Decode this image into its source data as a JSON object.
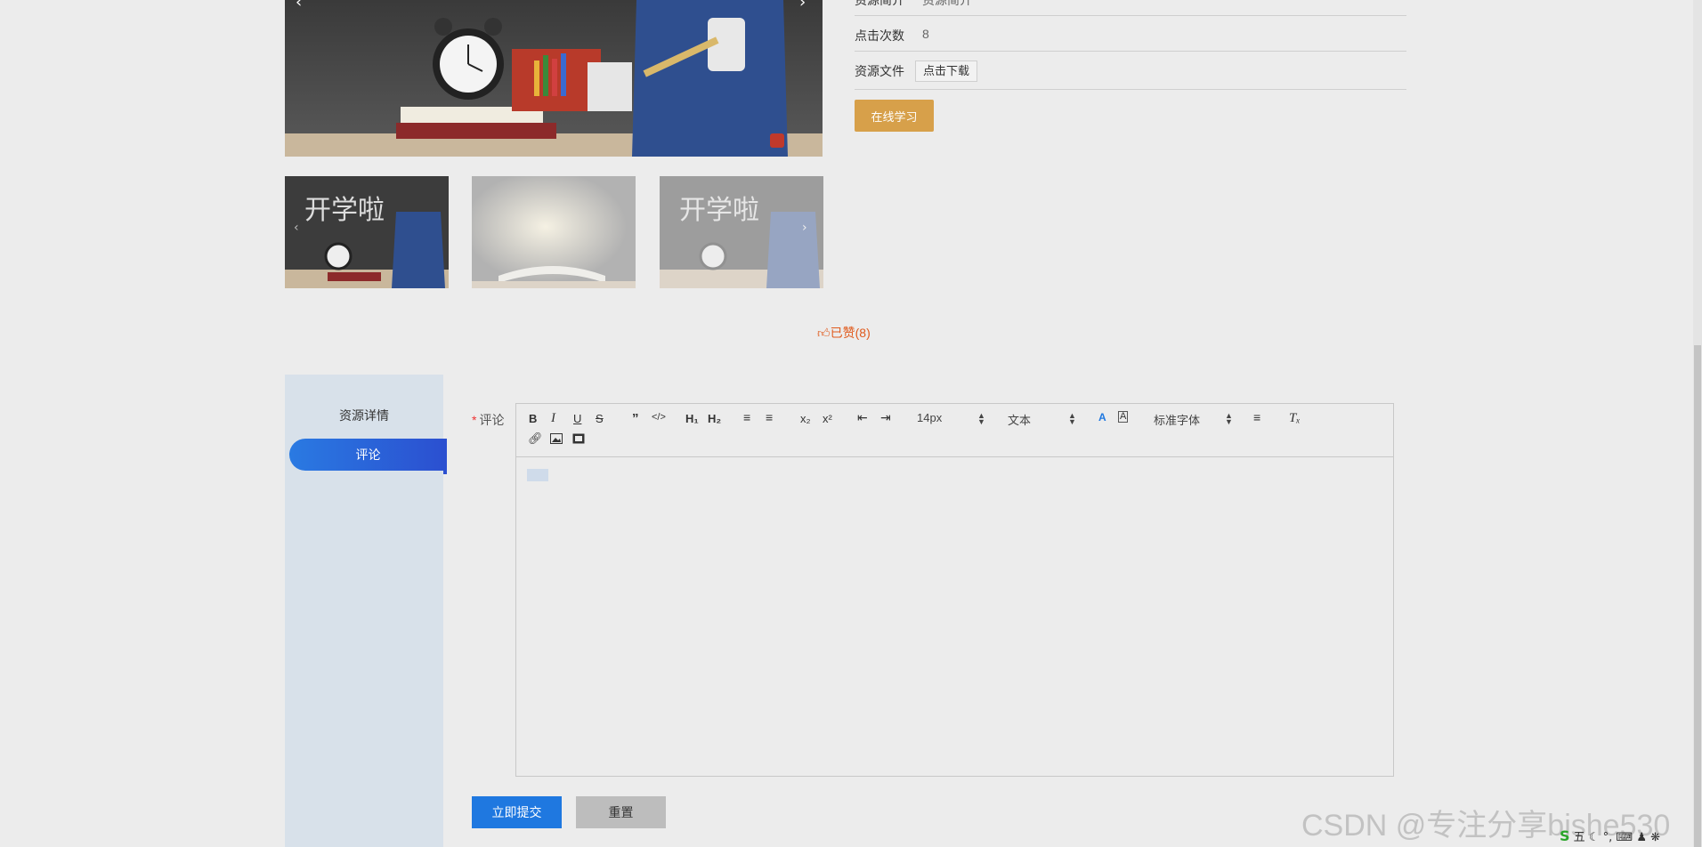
{
  "info": {
    "intro_label": "资源简介",
    "intro_value": "资源简介",
    "clicks_label": "点击次数",
    "clicks_value": "8",
    "file_label": "资源文件",
    "download_label": "点击下载",
    "learn_label": "在线学习"
  },
  "like": {
    "icon": "thumbs-up",
    "text": "已赞(8)"
  },
  "tabs": {
    "detail": "资源详情",
    "comment": "评论"
  },
  "form": {
    "required_mark": "*",
    "comment_label": "评论",
    "submit_label": "立即提交",
    "reset_label": "重置"
  },
  "editor": {
    "font_size": "14px",
    "heading": "文本",
    "font_family": "标准字体",
    "h1": "H₁",
    "h2": "H₂"
  },
  "watermark": "CSDN @专注分享bishe530",
  "tray": {
    "ime": "五",
    "logo": "S"
  },
  "colors": {
    "accent": "#1f78e0",
    "learn": "#d7a04a",
    "like": "#e05a1c",
    "sidebar": "#d8e1ea"
  }
}
